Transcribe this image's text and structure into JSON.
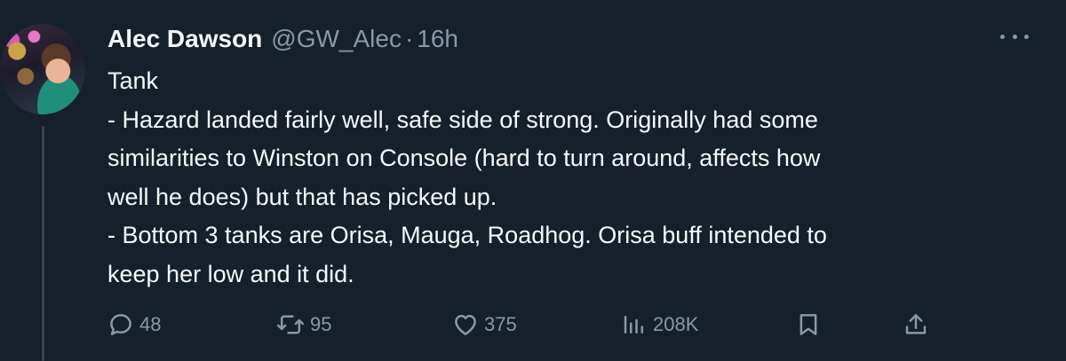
{
  "author": {
    "display_name": "Alec Dawson",
    "handle": "@GW_Alec",
    "separator": "·",
    "time": "16h",
    "avatar_icon": "profile-photo"
  },
  "more_icon": "more-horizontal-icon",
  "tweet": {
    "lines": [
      "Tank",
      "- Hazard landed fairly well, safe side of strong. Originally had some",
      "similarities to Winston on Console (hard to turn around, affects how",
      "well he does) but that has picked up.",
      "- Bottom 3 tanks are Orisa, Mauga, Roadhog. Orisa buff intended to",
      "keep her low and it did."
    ]
  },
  "actions": {
    "replies": "48",
    "retweets": "95",
    "likes": "375",
    "views": "208K"
  },
  "colors": {
    "background": "#15202b",
    "text": "#f7f9f9",
    "secondary": "#8b98a5",
    "thread_line": "#3a444f"
  }
}
